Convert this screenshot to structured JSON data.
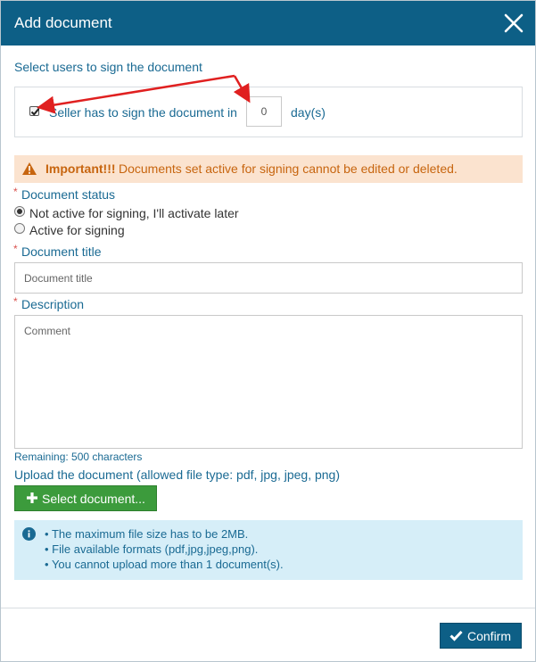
{
  "dialog": {
    "title": "Add document"
  },
  "signers": {
    "section_label": "Select users to sign the document",
    "seller_label": "Seller has to sign the document in",
    "seller_checked": true,
    "days_value": "0",
    "days_unit": "day(s)"
  },
  "warning": {
    "strong": "Important!!!",
    "text": "Documents set active for signing cannot be edited or deleted."
  },
  "status": {
    "label": "Document status",
    "options": [
      {
        "label": "Not active for signing, I'll activate later",
        "selected": true
      },
      {
        "label": "Active for signing",
        "selected": false
      }
    ]
  },
  "title_field": {
    "label": "Document title",
    "placeholder": "Document title",
    "value": ""
  },
  "description": {
    "label": "Description",
    "placeholder": "Comment",
    "remaining": "Remaining: 500 characters"
  },
  "upload": {
    "label": "Upload the document (allowed file type: pdf, jpg, jpeg, png)",
    "button_label": "Select document..."
  },
  "info": {
    "items": [
      "The maximum file size has to be 2MB.",
      "File available formats (pdf,jpg,jpeg,png).",
      "You cannot upload more than 1 document(s)."
    ]
  },
  "footer": {
    "confirm_label": "Confirm"
  },
  "colors": {
    "header_bg": "#0d5f86",
    "label_blue": "#1a6a93",
    "warning_bg": "#fbe3cf",
    "warning_text": "#c7650f",
    "info_bg": "#d6eef8",
    "success_green": "#3c9b3c",
    "required_red": "#d9534f",
    "annotation_red": "#e02020"
  },
  "icons": [
    "close-icon",
    "checkbox-check-icon",
    "warning-triangle-icon",
    "plus-icon",
    "info-circle-icon",
    "check-icon",
    "annotation-arrow"
  ]
}
